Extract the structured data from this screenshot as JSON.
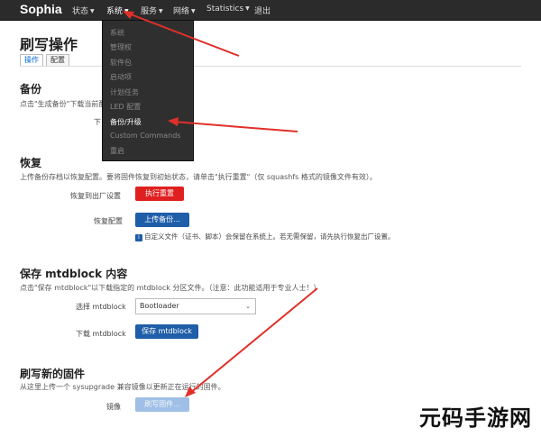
{
  "navbar": {
    "brand": "Sophia",
    "items": [
      {
        "label": "状态"
      },
      {
        "label": "系统"
      },
      {
        "label": "服务"
      },
      {
        "label": "网络"
      },
      {
        "label": "Statistics"
      },
      {
        "label": "退出"
      }
    ]
  },
  "dropdown": {
    "items": [
      {
        "label": "系统"
      },
      {
        "label": "管理权"
      },
      {
        "label": "软件包"
      },
      {
        "label": "启动项"
      },
      {
        "label": "计划任务"
      },
      {
        "label": "LED 配置"
      },
      {
        "label": "备份/升级"
      },
      {
        "label": "Custom Commands"
      },
      {
        "label": "重启"
      }
    ]
  },
  "page": {
    "title": "刷写操作",
    "tabs": [
      {
        "label": "操作"
      },
      {
        "label": "配置"
      }
    ]
  },
  "backup": {
    "heading": "备份",
    "desc": "点击\"生成备份\"下载当前配",
    "label": "下"
  },
  "restore": {
    "heading": "恢复",
    "desc": "上传备份存档以恢复配置。要将固件恢复到初始状态，请单击\"执行重置\"（仅 squashfs 格式的镜像文件有效）。",
    "reset_label": "恢复到出厂设置",
    "reset_button": "执行重置",
    "restore_label": "恢复配置",
    "upload_button": "上传备份...",
    "hint": "自定义文件（证书、脚本）会保留在系统上。若无需保留，请先执行恢复出厂设置。"
  },
  "mtd": {
    "heading": "保存 mtdblock 内容",
    "desc": "点击\"保存 mtdblock\"以下载指定的 mtdblock 分区文件。（注意：此功能适用于专业人士！）",
    "select_label": "选择 mtdblock",
    "select_value": "Bootloader",
    "download_label": "下载 mtdblock",
    "save_button": "保存 mtdblock"
  },
  "flash": {
    "heading": "刷写新的固件",
    "desc": "从这里上传一个 sysupgrade 兼容镜像以更新正在运行的固件。",
    "image_label": "镜像",
    "flash_button": "刷写固件..."
  },
  "watermark": "元码手游网",
  "colors": {
    "arrow": "#e0302a",
    "navbar": "#2b2b2b",
    "accent": "#1f5ea8",
    "danger": "#e02020"
  }
}
